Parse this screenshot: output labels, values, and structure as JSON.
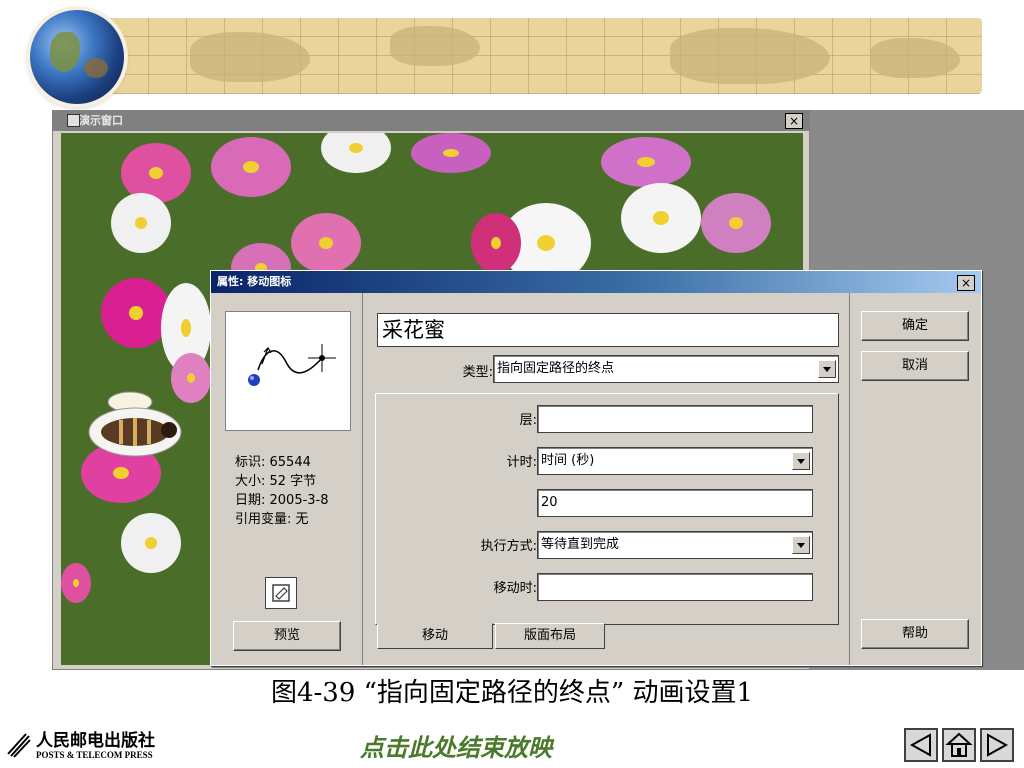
{
  "demo_window": {
    "title": "演示窗口",
    "close_glyph": "×"
  },
  "dialog": {
    "title": "属性: 移动图标",
    "close_glyph": "×",
    "icon_title": "采花蜜",
    "type_label": "类型:",
    "type_value": "指向固定路径的终点",
    "layer_label": "层:",
    "layer_value": "",
    "timing_label": "计时:",
    "timing_value": "时间 (秒)",
    "timing_amount": "20",
    "exec_label": "执行方式:",
    "exec_value": "等待直到完成",
    "move_when_label": "移动时:",
    "move_when_value": "",
    "info": {
      "id": "标识: 65544",
      "size": "大小: 52 字节",
      "date": "日期: 2005-3-8",
      "ref": "引用变量: 无"
    },
    "buttons": {
      "ok": "确定",
      "cancel": "取消",
      "help": "帮助",
      "preview": "预览"
    },
    "tabs": [
      "移动",
      "版面布局"
    ]
  },
  "caption": "图4-39 “指向固定路径的终点” 动画设置1",
  "footer": {
    "publisher_cn": "人民邮电出版社",
    "publisher_en": "POSTS & TELECOM PRESS",
    "end_show": "点击此处结束放映"
  },
  "icons": [
    "globe-icon",
    "window-icon",
    "close-icon",
    "motion-path-icon",
    "edit-icon",
    "dropdown-arrow-icon",
    "prev-icon",
    "home-icon",
    "next-icon",
    "publisher-logo-icon"
  ],
  "colors": {
    "dialog_bg": "#d4d0c8",
    "title_bar_start": "#0a246a",
    "title_bar_end": "#a6caf0",
    "end_show_text": "#4a7a2a"
  }
}
